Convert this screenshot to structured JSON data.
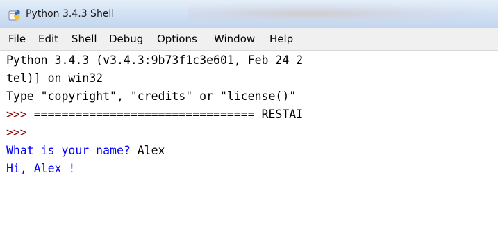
{
  "window": {
    "title": "Python 3.4.3 Shell",
    "icon": "python-icon"
  },
  "menu": {
    "items": [
      "File",
      "Edit",
      "Shell",
      "Debug",
      "Options",
      "Window",
      "Help"
    ]
  },
  "shell": {
    "banner_line1": "Python 3.4.3 (v3.4.3:9b73f1c3e601, Feb 24 2",
    "banner_line2": "tel)] on win32",
    "banner_line3": "Type \"copyright\", \"credits\" or \"license()\"",
    "restart_prompt": ">>> ",
    "restart_text": "================================ RESTAI",
    "prompt2": ">>>",
    "question": "What is your name? ",
    "answer": "Alex",
    "greeting": "Hi, Alex !"
  },
  "colors": {
    "prompt": "#8b0000",
    "stdout": "#0000ff",
    "stdin": "#000000"
  }
}
